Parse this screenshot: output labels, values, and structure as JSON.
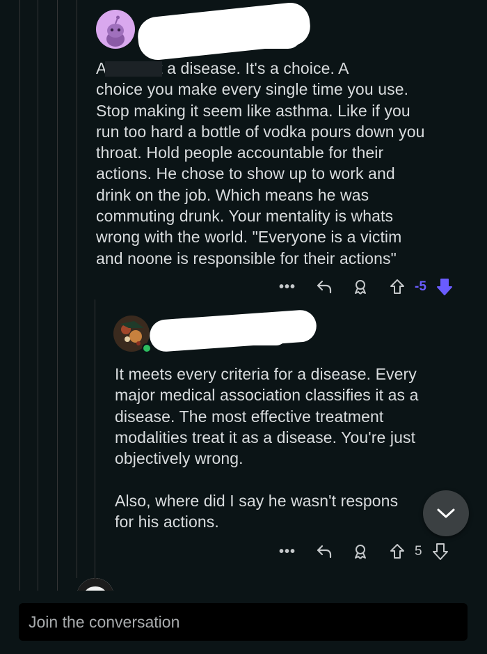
{
  "comment_1": {
    "text": "A          n is not a disease. It's a choice. A\nchoice you make every single time you use.\nStop making it seem like asthma. Like if you\nrun too hard a bottle of vodka pours down you\nthroat. Hold people accountable for their\nactions. He chose to show up to work and\ndrink on the job. Which means he was\ncommuting drunk. Your mentality is whats\nwrong with the world. \"Everyone is a victim\nand noone is responsible for their actions\"",
    "score": "-5",
    "more_label": "•••",
    "vote_state": "downvoted"
  },
  "comment_2": {
    "text": "It meets every criteria for a disease. Every\nmajor medical association classifies it as a\ndisease. The most effective treatment\nmodalities treat it as a disease. You're just\nobjectively wrong.\n\nAlso, where did I say he wasn't respons\nfor his actions.",
    "score": "5",
    "more_label": "•••"
  },
  "composer": {
    "placeholder": "Join the conversation"
  },
  "colors": {
    "background": "#0b1416",
    "downvote_active": "#6a5cff",
    "text": "#d9dcde",
    "online": "#2dbd5f"
  },
  "icons": {
    "reply": "reply-icon",
    "award": "award-icon",
    "upvote": "upvote-icon",
    "downvote": "downvote-icon",
    "collapse": "chevron-down-icon"
  }
}
